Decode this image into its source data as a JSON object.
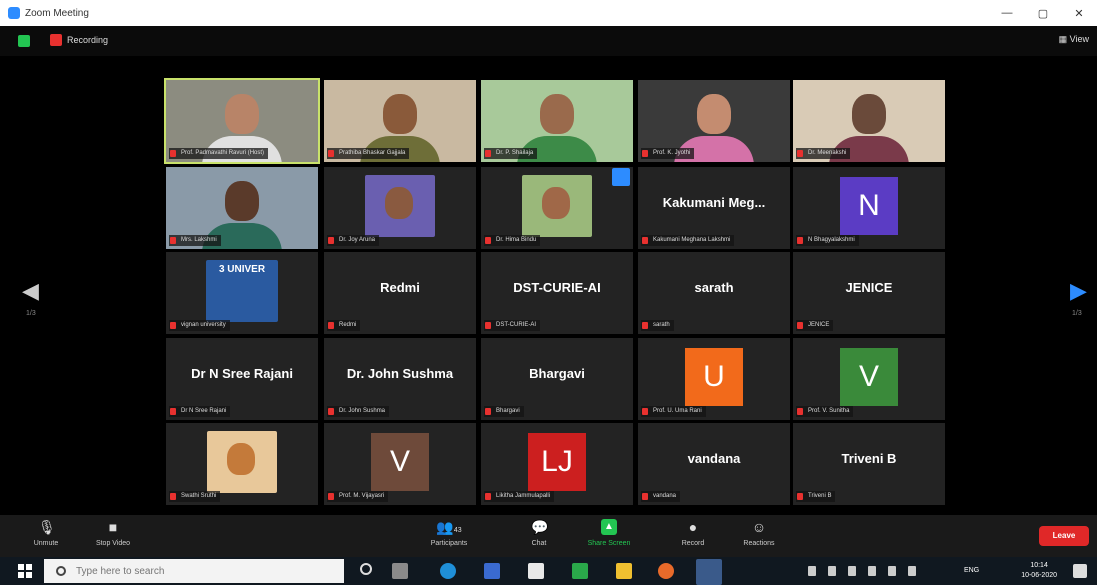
{
  "window": {
    "title": "Zoom Meeting",
    "minimize": "—",
    "maximize": "▢",
    "close": "✕"
  },
  "topbar": {
    "recording_label": "Recording",
    "view_label": "View"
  },
  "gallery": {
    "prev_page": "1/3",
    "next_page": "1/3",
    "tiles": [
      {
        "type": "video",
        "tag": "Prof. Padmavathi Ravuri (Host)",
        "active": true,
        "bg": "#8c8c80",
        "skin": "#b88468",
        "cloth": "#e0e0e0"
      },
      {
        "type": "video",
        "tag": "Prathiba Bhaskar Gajjala",
        "bg": "#c9b9a1",
        "skin": "#8a5a3a",
        "cloth": "#6e6e38"
      },
      {
        "type": "video",
        "tag": "Dr. P. Shailaja",
        "bg": "#a8c99a",
        "skin": "#9a6a4c",
        "cloth": "#3d8b48"
      },
      {
        "type": "video",
        "tag": "Prof. K. Jyothi",
        "bg": "#3a3a3a",
        "skin": "#c48c70",
        "cloth": "#d472a8"
      },
      {
        "type": "video",
        "tag": "Dr. Meenakshi",
        "bg": "#d9cbb6",
        "skin": "#6a4a3a",
        "cloth": "#7a3a4a"
      },
      {
        "type": "video",
        "tag": "Mrs. Lakshmi",
        "bg": "#8a9aa8",
        "skin": "#5a3a2a",
        "cloth": "#2a6a5a"
      },
      {
        "type": "photo",
        "tag": "Dr. Joy Aruna",
        "photo_bg": "#6a5fb0",
        "skin": "#8a5a40"
      },
      {
        "type": "photo",
        "tag": "Dr. Hima Bindu",
        "photo_bg": "#9ab87a",
        "skin": "#a06848"
      },
      {
        "type": "name",
        "label": "Kakumani Meg...",
        "tag": "Kakumani Meghana Lakshmi"
      },
      {
        "type": "avatar",
        "letter": "N",
        "color": "#5b3cc4",
        "tag": "N Bhagyalakshmi"
      },
      {
        "type": "banner",
        "banner_text": "3 UNIVER",
        "tag": "vignan university"
      },
      {
        "type": "name",
        "label": "Redmi",
        "tag": "Redmi"
      },
      {
        "type": "name",
        "label": "DST-CURIE-AI",
        "tag": "DST-CURIE-AI"
      },
      {
        "type": "name",
        "label": "sarath",
        "tag": "sarath"
      },
      {
        "type": "name",
        "label": "JENICE",
        "tag": "JENICE"
      },
      {
        "type": "name",
        "label": "Dr N Sree Rajani",
        "tag": "Dr N Sree Rajani"
      },
      {
        "type": "name",
        "label": "Dr. John Sushma",
        "tag": "Dr. John Sushma"
      },
      {
        "type": "name",
        "label": "Bhargavi",
        "tag": "Bhargavi"
      },
      {
        "type": "avatar",
        "letter": "U",
        "color": "#f26a1b",
        "tag": "Prof. U. Uma Rani"
      },
      {
        "type": "avatar",
        "letter": "V",
        "color": "#3a8a3a",
        "tag": "Prof. V. Sunitha"
      },
      {
        "type": "photo",
        "tag": "Swathi Sruthi",
        "photo_bg": "#e8c89a",
        "skin": "#c47a3a"
      },
      {
        "type": "avatar",
        "letter": "V",
        "color": "#6e4a3a",
        "tag": "Prof. M. Vijayasri"
      },
      {
        "type": "avatar",
        "letter": "LJ",
        "color": "#cc1f1f",
        "tag": "Likitha Jammulapalli"
      },
      {
        "type": "name",
        "label": "vandana",
        "tag": "vandana"
      },
      {
        "type": "name",
        "label": "Triveni B",
        "tag": "Triveni B"
      }
    ]
  },
  "toolbar": {
    "unmute": "Unmute",
    "stop_video": "Stop Video",
    "participants": "Participants",
    "participants_count": "43",
    "chat": "Chat",
    "share_screen": "Share Screen",
    "record": "Record",
    "reactions": "Reactions",
    "leave": "Leave"
  },
  "taskbar": {
    "search_placeholder": "Type here to search",
    "lang": "ENG",
    "time": "10:14",
    "date": "10-06-2020"
  }
}
